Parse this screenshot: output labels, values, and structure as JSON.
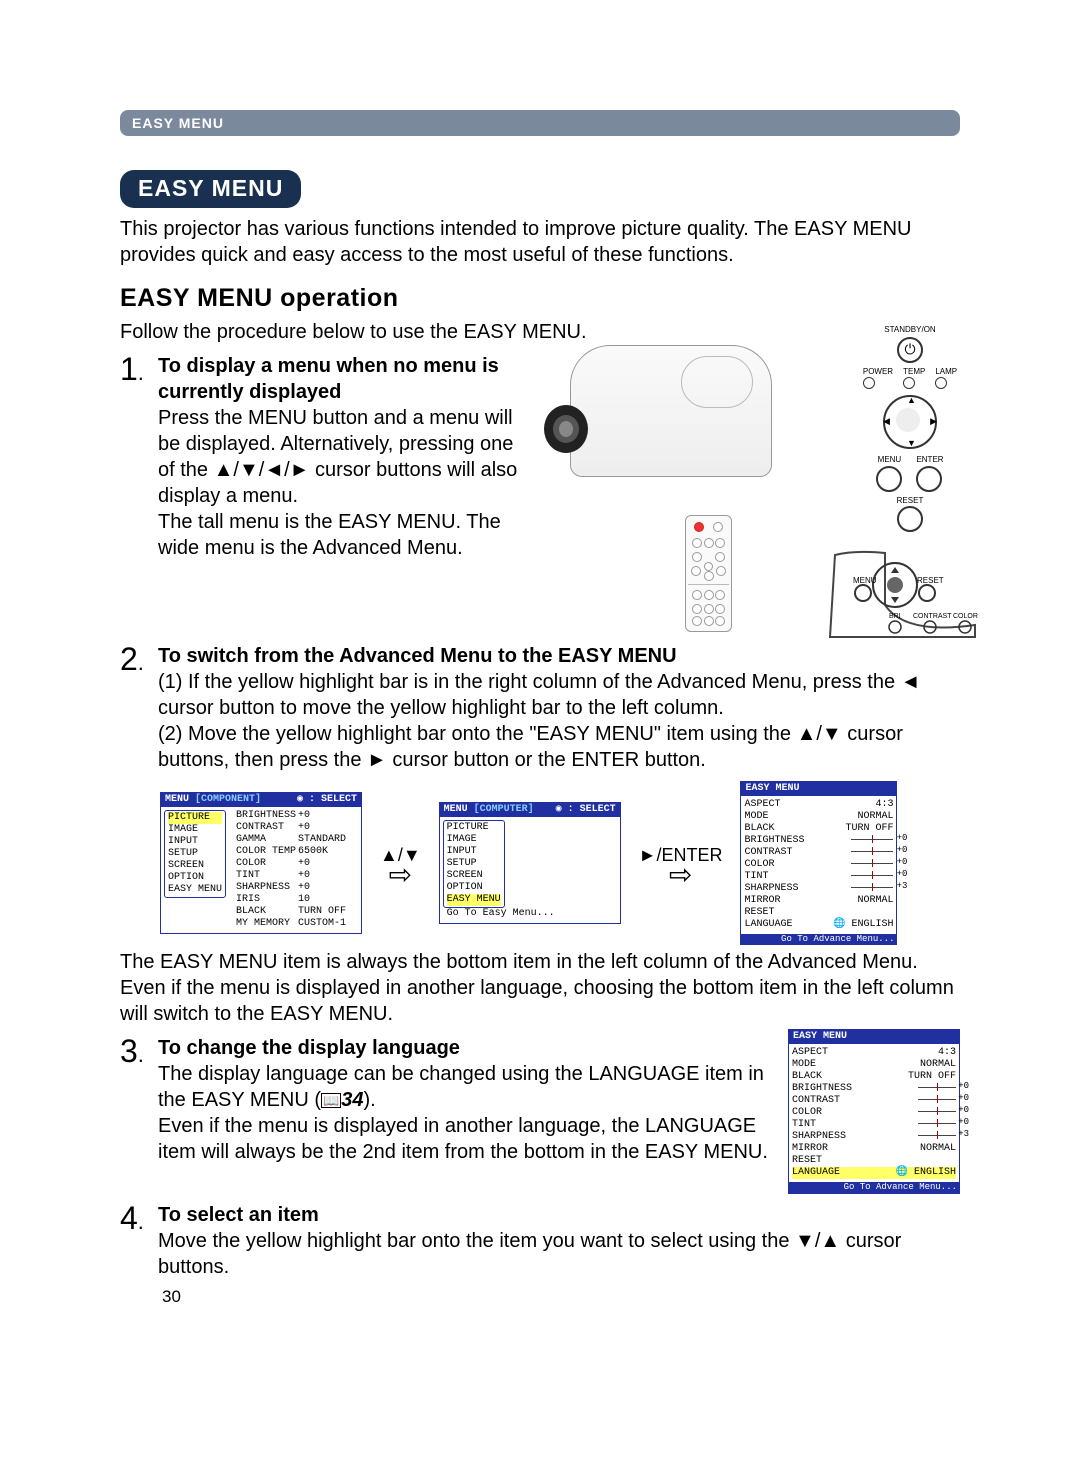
{
  "header_bar": "EASY MENU",
  "title_pill": "EASY MENU",
  "intro": "This projector has various functions intended to improve picture quality. The EASY MENU provides quick and easy access to the most useful of these functions.",
  "h2": "EASY MENU operation",
  "follow": "Follow the procedure below to use the EASY MENU.",
  "step1": {
    "num": "1",
    "title": "To display a menu when no menu is currently displayed",
    "p1": "Press the MENU button and a menu will be displayed. Alternatively, pressing one of the ▲/▼/◄/► cursor buttons will also display a menu.",
    "p2": "The tall menu is the EASY MENU. The wide menu is the Advanced Menu."
  },
  "hero": {
    "standby_lbl": "STANDBY/ON",
    "power_lbl": "POWER",
    "temp_lbl": "TEMP",
    "lamp_lbl": "LAMP",
    "menu_lbl": "MENU",
    "enter_lbl": "ENTER",
    "reset_lbl": "RESET",
    "panel2_menu": "MENU",
    "panel2_reset": "RESET",
    "panel2_bri": "BRI",
    "panel2_col": "CONTRAST  COLOR"
  },
  "step2": {
    "num": "2",
    "title": "To switch from the Advanced Menu to the EASY MENU",
    "li1": "(1) If the yellow highlight bar is in the right column of the Advanced Menu, press the ◄ cursor button to move the yellow highlight bar to the left column.",
    "li2": "(2) Move the yellow highlight bar onto the \"EASY MENU\" item using the ▲/▼ cursor buttons, then press the ► cursor button or the ENTER button."
  },
  "advanced_menu1": {
    "menu_label": "MENU",
    "source": "[COMPONENT]",
    "select": ": SELECT",
    "left": [
      "PICTURE",
      "IMAGE",
      "INPUT",
      "SETUP",
      "SCREEN",
      "OPTION",
      "EASY MENU"
    ],
    "right_labels": [
      "BRIGHTNESS",
      "CONTRAST",
      "GAMMA",
      "COLOR TEMP",
      "COLOR",
      "TINT",
      "SHARPNESS",
      "IRIS",
      "BLACK",
      "MY MEMORY"
    ],
    "right_values": [
      "+0",
      "+0",
      "STANDARD",
      "6500K",
      "+0",
      "+0",
      "+0",
      "10",
      "TURN OFF",
      "CUSTOM-1"
    ]
  },
  "mid_arrows": {
    "updown": "▲/▼",
    "enter": "►/ENTER"
  },
  "advanced_menu2": {
    "menu_label": "MENU",
    "source": "[COMPUTER]",
    "select": ": SELECT",
    "left": [
      "PICTURE",
      "IMAGE",
      "INPUT",
      "SETUP",
      "SCREEN",
      "OPTION",
      "EASY MENU"
    ],
    "right_text": "Go To Easy Menu..."
  },
  "easy_menu_box": {
    "title": "EASY MENU",
    "rows": [
      {
        "l": "ASPECT",
        "v": "4:3",
        "type": "text"
      },
      {
        "l": "MODE",
        "v": "NORMAL",
        "type": "text"
      },
      {
        "l": "BLACK",
        "v": "TURN OFF",
        "type": "text"
      },
      {
        "l": "BRIGHTNESS",
        "v": "+0",
        "type": "slider"
      },
      {
        "l": "CONTRAST",
        "v": "+0",
        "type": "slider"
      },
      {
        "l": "COLOR",
        "v": "+0",
        "type": "slider"
      },
      {
        "l": "TINT",
        "v": "+0",
        "type": "slider"
      },
      {
        "l": "SHARPNESS",
        "v": "+3",
        "type": "slider"
      },
      {
        "l": "MIRROR",
        "v": "NORMAL",
        "type": "text"
      },
      {
        "l": "RESET",
        "v": "",
        "type": "text"
      },
      {
        "l": "LANGUAGE",
        "v": "ENGLISH",
        "type": "lang"
      }
    ],
    "footer": "Go To Advance Menu..."
  },
  "after_diagram": "The EASY MENU item is always the bottom item in the left column of the Advanced Menu. Even if the menu is displayed in another language, choosing the bottom item in the left column will switch to the EASY MENU.",
  "step3": {
    "num": "3",
    "title": "To change the display language",
    "p1a": "The display language can be changed using the LANGUAGE item in the EASY MENU (",
    "p1_ref": "34",
    "p1b": ").",
    "p2": "Even if the menu is displayed in another language, the LANGUAGE item will always be the 2nd item from the bottom in the EASY MENU."
  },
  "easy_menu_box2_highlight": "LANGUAGE",
  "step4": {
    "num": "4",
    "title": "To select an item",
    "p": "Move the yellow highlight bar onto the item you want to select using the ▼/▲ cursor buttons."
  },
  "page_num": "30"
}
